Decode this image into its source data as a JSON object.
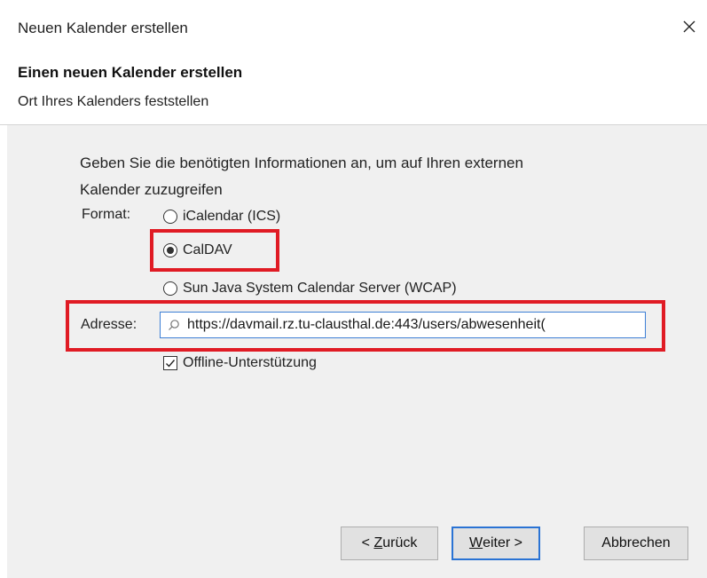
{
  "window": {
    "title": "Neuen Kalender erstellen",
    "close_symbol": "×"
  },
  "header": {
    "title": "Einen neuen Kalender erstellen",
    "subtitle": "Ort Ihres Kalenders feststellen"
  },
  "form": {
    "intro_line1": "Geben Sie die benötigten Informationen an, um auf Ihren externen",
    "intro_line2": "Kalender zuzugreifen",
    "format_label": "Format:",
    "formats": [
      {
        "label": "iCalendar (ICS)",
        "checked": false
      },
      {
        "label": "CalDAV",
        "checked": true
      },
      {
        "label": "Sun Java System Calendar Server (WCAP)",
        "checked": false
      }
    ],
    "address_label": "Adresse:",
    "address_value": "https://davmail.rz.tu-clausthal.de:443/users/abwesenheit(",
    "offline_label": "Offline-Unterstützung",
    "offline_checked": true
  },
  "buttons": {
    "back_prefix": "< ",
    "back_accel": "Z",
    "back_rest": "urück",
    "next_accel": "W",
    "next_rest": "eiter >",
    "cancel": "Abbrechen"
  },
  "colors": {
    "highlight": "#e01b24",
    "focus": "#3d7fd6"
  }
}
